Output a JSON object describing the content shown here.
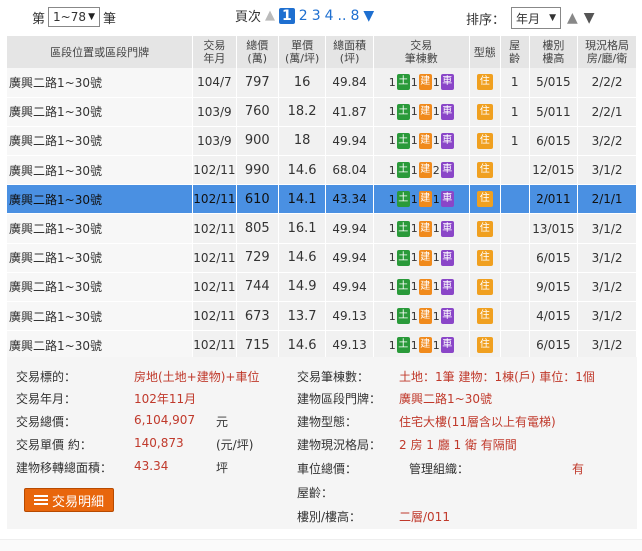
{
  "pager": {
    "range_prefix": "第",
    "range_value": "1~78",
    "range_suffix": "筆",
    "page_label": "頁次",
    "pages": [
      "1",
      "2",
      "3",
      "4"
    ],
    "ellipsis": "..",
    "last_page": "8",
    "sort_label": "排序：",
    "sort_value": "年月"
  },
  "table": {
    "headers": [
      "區段位置或區段門牌",
      "交易\n年月",
      "總價\n(萬)",
      "單價\n(萬/坪)",
      "總面積\n(坪)",
      "交易\n筆棟數",
      "型態",
      "屋\n齡",
      "樓別\n樓高",
      "現況格局\n房/廳/衛"
    ],
    "rows": [
      {
        "addr": "廣興二路1~30號",
        "ym": "104/7",
        "total": "797",
        "unit": "16",
        "area": "49.84",
        "land": "1",
        "bldg": "1",
        "park": "1",
        "type": "住",
        "age": "1",
        "floor": "5/015",
        "layout": "2/2/2"
      },
      {
        "addr": "廣興二路1~30號",
        "ym": "103/9",
        "total": "760",
        "unit": "18.2",
        "area": "41.87",
        "land": "1",
        "bldg": "1",
        "park": "1",
        "type": "住",
        "age": "1",
        "floor": "5/011",
        "layout": "2/2/1"
      },
      {
        "addr": "廣興二路1~30號",
        "ym": "103/9",
        "total": "900",
        "unit": "18",
        "area": "49.94",
        "land": "1",
        "bldg": "1",
        "park": "1",
        "type": "住",
        "age": "1",
        "floor": "6/015",
        "layout": "3/2/2"
      },
      {
        "addr": "廣興二路1~30號",
        "ym": "102/11",
        "total": "990",
        "unit": "14.6",
        "area": "68.04",
        "land": "1",
        "bldg": "1",
        "park": "2",
        "type": "住",
        "age": "",
        "floor": "12/015",
        "layout": "3/1/2"
      },
      {
        "addr": "廣興二路1~30號",
        "ym": "102/11",
        "total": "610",
        "unit": "14.1",
        "area": "43.34",
        "land": "1",
        "bldg": "1",
        "park": "1",
        "type": "住",
        "age": "",
        "floor": "2/011",
        "layout": "2/1/1",
        "selected": true
      },
      {
        "addr": "廣興二路1~30號",
        "ym": "102/11",
        "total": "805",
        "unit": "16.1",
        "area": "49.94",
        "land": "1",
        "bldg": "1",
        "park": "1",
        "type": "住",
        "age": "",
        "floor": "13/015",
        "layout": "3/1/2"
      },
      {
        "addr": "廣興二路1~30號",
        "ym": "102/11",
        "total": "729",
        "unit": "14.6",
        "area": "49.94",
        "land": "1",
        "bldg": "1",
        "park": "1",
        "type": "住",
        "age": "",
        "floor": "6/015",
        "layout": "3/1/2"
      },
      {
        "addr": "廣興二路1~30號",
        "ym": "102/11",
        "total": "744",
        "unit": "14.9",
        "area": "49.94",
        "land": "1",
        "bldg": "1",
        "park": "1",
        "type": "住",
        "age": "",
        "floor": "9/015",
        "layout": "3/1/2"
      },
      {
        "addr": "廣興二路1~30號",
        "ym": "102/11",
        "total": "673",
        "unit": "13.7",
        "area": "49.13",
        "land": "1",
        "bldg": "1",
        "park": "1",
        "type": "住",
        "age": "",
        "floor": "4/015",
        "layout": "3/1/2"
      },
      {
        "addr": "廣興二路1~30號",
        "ym": "102/11",
        "total": "715",
        "unit": "14.6",
        "area": "49.13",
        "land": "1",
        "bldg": "1",
        "park": "1",
        "type": "住",
        "age": "",
        "floor": "6/015",
        "layout": "3/1/2"
      }
    ],
    "badge_land": "土",
    "badge_bldg": "建",
    "badge_park": "車"
  },
  "detail": {
    "target_label": "交易標的：",
    "target_value": "房地(土地+建物)+車位",
    "ym_label": "交易年月：",
    "ym_value": "102年11月",
    "total_label": "交易總價：",
    "total_value": "6,104,907",
    "total_unit": "元",
    "unit_label": "交易單價 約：",
    "unit_value": "140,873",
    "unit_unit": "(元/坪)",
    "area_label": "建物移轉總面積：",
    "area_value": "43.34",
    "area_unit": "坪",
    "count_label": "交易筆棟數：",
    "count_value": "土地：1筆 建物：1棟(戶) 車位：1個",
    "addr_label": "建物區段門牌：",
    "addr_value": "廣興二路1~30號",
    "btype_label": "建物型態：",
    "btype_value": "住宅大樓(11層含以上有電梯)",
    "layout_label": "建物現況格局：",
    "layout_value": "2 房 1 廳 1 衛 有隔間",
    "park_label": "車位總價：",
    "mgmt_label": "管理組織：",
    "mgmt_value": "有",
    "age_label": "屋齡：",
    "floor_label": "樓別/樓高：",
    "floor_value": "二層/011",
    "button_label": "交易明細"
  }
}
